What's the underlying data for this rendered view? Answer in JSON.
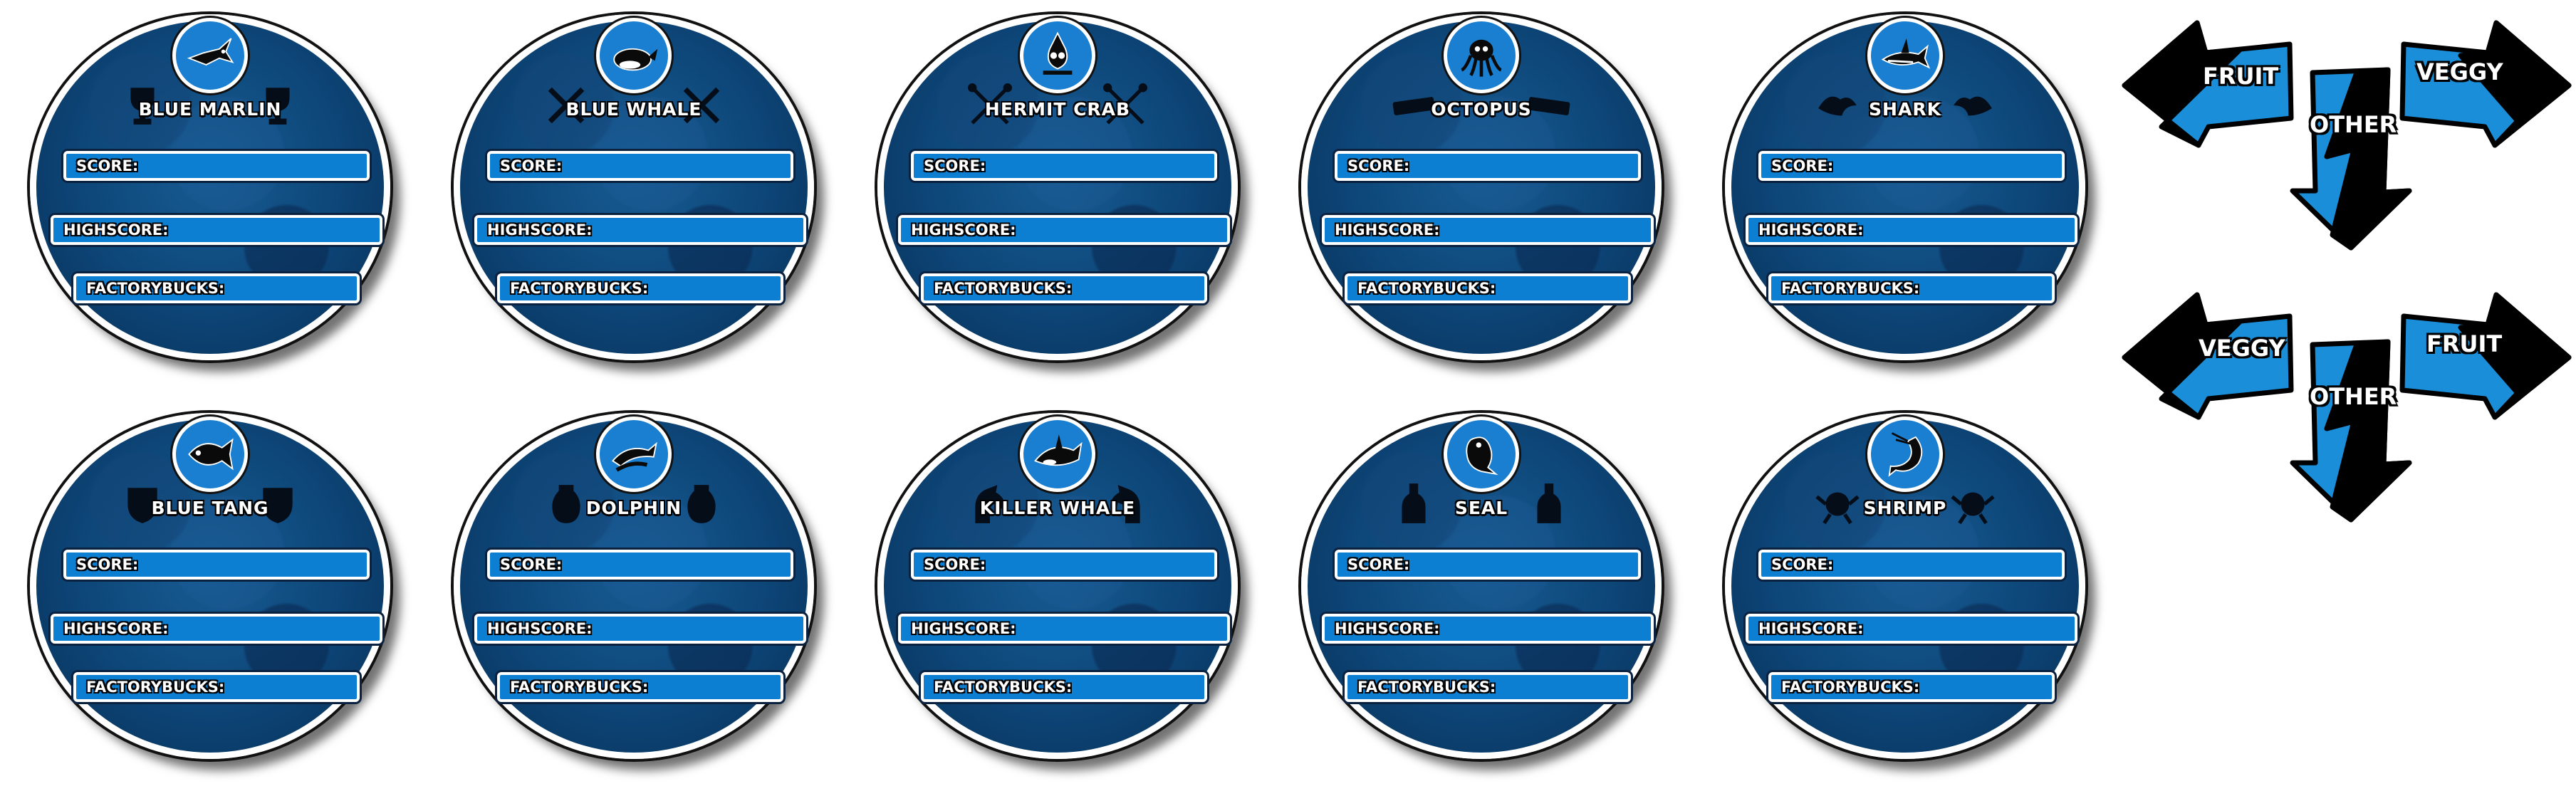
{
  "field_labels": {
    "score": "SCORE:",
    "highscore": "HIGHSCORE:",
    "factorybucks": "FACTORYBUCKS:"
  },
  "cards": [
    {
      "name": "BLUE MARLIN",
      "icon": "marlin-icon",
      "deco": "trophy-icon"
    },
    {
      "name": "BLUE WHALE",
      "icon": "whale-icon",
      "deco": "crossed-swords-icon"
    },
    {
      "name": "HERMIT CRAB",
      "icon": "crab-icon",
      "deco": "crossed-tools-icon"
    },
    {
      "name": "OCTOPUS",
      "icon": "octopus-icon",
      "deco": "bar-icon"
    },
    {
      "name": "SHARK",
      "icon": "shark-icon",
      "deco": "bird-icon"
    },
    {
      "name": "BLUE TANG",
      "icon": "tang-icon",
      "deco": "shield-icon"
    },
    {
      "name": "DOLPHIN",
      "icon": "dolphin-icon",
      "deco": "vase-icon"
    },
    {
      "name": "KILLER WHALE",
      "icon": "orca-icon",
      "deco": "horse-icon"
    },
    {
      "name": "SEAL",
      "icon": "seal-icon",
      "deco": "bottle-icon"
    },
    {
      "name": "SHRIMP",
      "icon": "shrimp-icon",
      "deco": "creature-icon"
    }
  ],
  "arrows": [
    {
      "left": "FRUIT",
      "right": "VEGGY",
      "down": "OTHER"
    },
    {
      "left": "VEGGY",
      "right": "FRUIT",
      "down": "OTHER"
    }
  ],
  "colors": {
    "card_blue": "#0d4577",
    "field_blue": "#0d7fd2",
    "arrow_blue": "#1a8ed8",
    "outline": "#000000"
  }
}
